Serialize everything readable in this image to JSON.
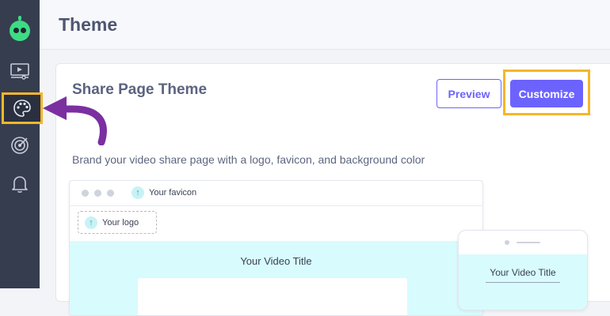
{
  "header": {
    "title": "Theme"
  },
  "sidebar": {
    "items": [
      {
        "icon": "robot-logo-icon"
      },
      {
        "icon": "video-library-icon"
      },
      {
        "icon": "palette-icon",
        "active": true
      },
      {
        "icon": "target-icon"
      },
      {
        "icon": "bell-icon"
      }
    ]
  },
  "card": {
    "title": "Share Page Theme",
    "description": "Brand your video share page with a logo, favicon, and background color",
    "preview_button": "Preview",
    "customize_button": "Customize"
  },
  "preview": {
    "favicon_label": "Your favicon",
    "logo_label": "Your logo",
    "video_title": "Your Video Title",
    "mobile_video_title": "Your Video Title"
  },
  "colors": {
    "accent": "#6c63ff",
    "highlight": "#f3b72b",
    "sidebar": "#363d4f",
    "hero_background": "#d8fbfd",
    "arrow": "#7b2fa0"
  }
}
